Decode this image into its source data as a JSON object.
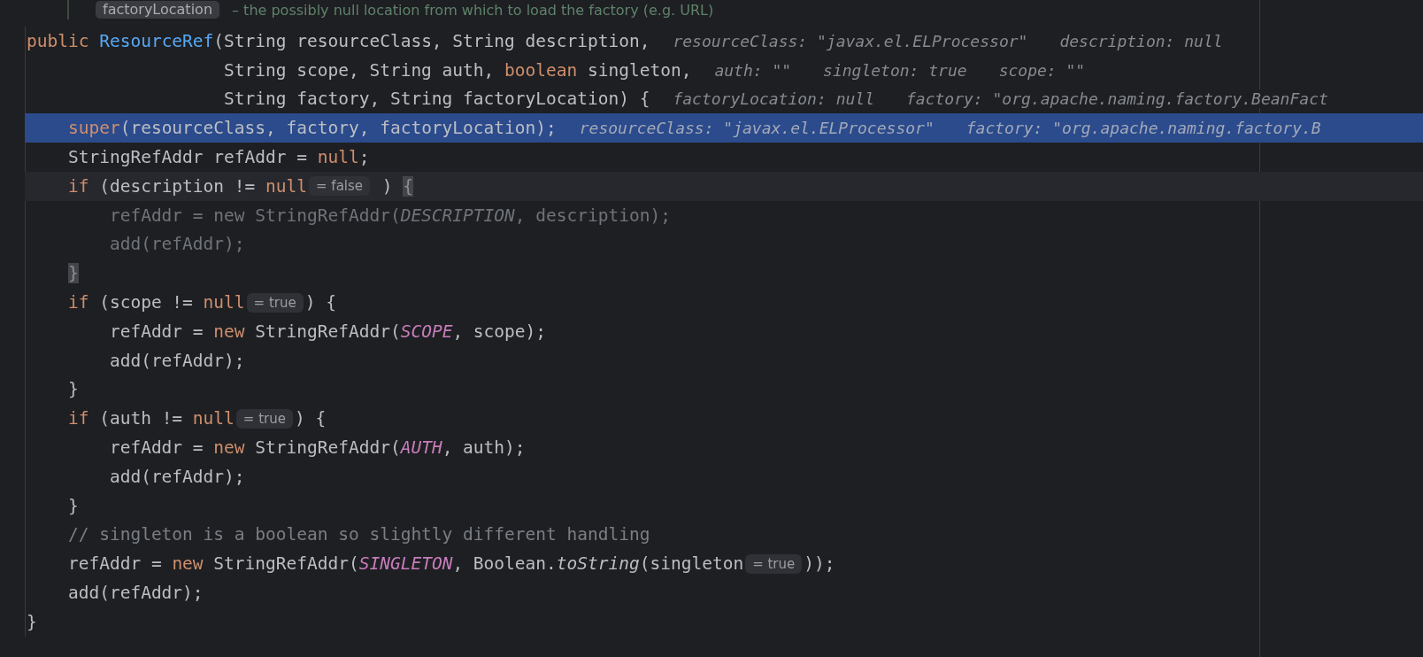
{
  "doc_comment": {
    "tag": "factoryLocation",
    "text": "– the possibly null location from which to load the factory (e.g. URL)"
  },
  "lines": [
    {
      "executing": false,
      "caret": false,
      "tokens": [
        {
          "kind": "keyword",
          "text": "public "
        },
        {
          "kind": "declaration",
          "text": "ResourceRef"
        },
        {
          "kind": "text",
          "text": "(String resourceClass, String description,"
        },
        {
          "kind": "hint",
          "text": "resourceClass: \"javax.el.ELProcessor\""
        },
        {
          "kind": "hint",
          "text": "description: null"
        }
      ]
    },
    {
      "executing": false,
      "caret": false,
      "tokens": [
        {
          "kind": "text",
          "text": "                   String scope, String auth, "
        },
        {
          "kind": "keyword",
          "text": "boolean"
        },
        {
          "kind": "text",
          "text": " singleton,"
        },
        {
          "kind": "hint",
          "text": "auth: \"\""
        },
        {
          "kind": "hint",
          "text": "singleton: true"
        },
        {
          "kind": "hint",
          "text": "scope: \"\""
        }
      ]
    },
    {
      "executing": false,
      "caret": false,
      "tokens": [
        {
          "kind": "text",
          "text": "                   String factory, String factoryLocation) {"
        },
        {
          "kind": "hint",
          "text": "factoryLocation: null"
        },
        {
          "kind": "hint",
          "text": "factory: \"org.apache.naming.factory.BeanFact"
        }
      ]
    },
    {
      "executing": true,
      "caret": false,
      "tokens": [
        {
          "kind": "keyword",
          "text": "    super"
        },
        {
          "kind": "text",
          "text": "(resourceClass, factory, factoryLocation);"
        },
        {
          "kind": "hint",
          "text": "resourceClass: \"javax.el.ELProcessor\""
        },
        {
          "kind": "hint",
          "text": "factory: \"org.apache.naming.factory.B"
        }
      ]
    },
    {
      "executing": false,
      "caret": false,
      "tokens": [
        {
          "kind": "text",
          "text": "    StringRefAddr refAddr = "
        },
        {
          "kind": "keyword",
          "text": "null"
        },
        {
          "kind": "text",
          "text": ";"
        }
      ]
    },
    {
      "executing": false,
      "caret": true,
      "tokens": [
        {
          "kind": "keyword",
          "text": "    if"
        },
        {
          "kind": "text",
          "text": " (description != "
        },
        {
          "kind": "keyword",
          "text": "null"
        },
        {
          "kind": "badge",
          "text": "= false"
        },
        {
          "kind": "text",
          "text": " ) "
        },
        {
          "kind": "brace_match",
          "text": "{"
        }
      ]
    },
    {
      "executing": false,
      "caret": false,
      "tokens": [
        {
          "kind": "dimmed",
          "text": "        refAddr = new StringRefAddr("
        },
        {
          "kind": "dimmed_constant",
          "text": "DESCRIPTION"
        },
        {
          "kind": "dimmed",
          "text": ", description);"
        }
      ]
    },
    {
      "executing": false,
      "caret": false,
      "tokens": [
        {
          "kind": "dimmed",
          "text": "        add(refAddr);"
        }
      ]
    },
    {
      "executing": false,
      "caret": false,
      "tokens": [
        {
          "kind": "brace_match",
          "text": "    }"
        }
      ]
    },
    {
      "executing": false,
      "caret": false,
      "tokens": [
        {
          "kind": "keyword",
          "text": "    if"
        },
        {
          "kind": "text",
          "text": " (scope != "
        },
        {
          "kind": "keyword",
          "text": "null"
        },
        {
          "kind": "badge",
          "text": "= true"
        },
        {
          "kind": "text",
          "text": ") {"
        }
      ]
    },
    {
      "executing": false,
      "caret": false,
      "tokens": [
        {
          "kind": "text",
          "text": "        refAddr = "
        },
        {
          "kind": "keyword",
          "text": "new"
        },
        {
          "kind": "text",
          "text": " StringRefAddr("
        },
        {
          "kind": "constant",
          "text": "SCOPE"
        },
        {
          "kind": "text",
          "text": ", scope);"
        }
      ]
    },
    {
      "executing": false,
      "caret": false,
      "tokens": [
        {
          "kind": "text",
          "text": "        add(refAddr);"
        }
      ]
    },
    {
      "executing": false,
      "caret": false,
      "tokens": [
        {
          "kind": "text",
          "text": "    }"
        }
      ]
    },
    {
      "executing": false,
      "caret": false,
      "tokens": [
        {
          "kind": "keyword",
          "text": "    if"
        },
        {
          "kind": "text",
          "text": " (auth != "
        },
        {
          "kind": "keyword",
          "text": "null"
        },
        {
          "kind": "badge",
          "text": "= true"
        },
        {
          "kind": "text",
          "text": ") {"
        }
      ]
    },
    {
      "executing": false,
      "caret": false,
      "tokens": [
        {
          "kind": "text",
          "text": "        refAddr = "
        },
        {
          "kind": "keyword",
          "text": "new"
        },
        {
          "kind": "text",
          "text": " StringRefAddr("
        },
        {
          "kind": "constant",
          "text": "AUTH"
        },
        {
          "kind": "text",
          "text": ", auth);"
        }
      ]
    },
    {
      "executing": false,
      "caret": false,
      "tokens": [
        {
          "kind": "text",
          "text": "        add(refAddr);"
        }
      ]
    },
    {
      "executing": false,
      "caret": false,
      "tokens": [
        {
          "kind": "text",
          "text": "    }"
        }
      ]
    },
    {
      "executing": false,
      "caret": false,
      "tokens": [
        {
          "kind": "comment",
          "text": "    // singleton is a boolean so slightly different handling"
        }
      ]
    },
    {
      "executing": false,
      "caret": false,
      "tokens": [
        {
          "kind": "text",
          "text": "    refAddr = "
        },
        {
          "kind": "keyword",
          "text": "new"
        },
        {
          "kind": "text",
          "text": " StringRefAddr("
        },
        {
          "kind": "constant",
          "text": "SINGLETON"
        },
        {
          "kind": "text",
          "text": ", Boolean."
        },
        {
          "kind": "method_call",
          "text": "toString"
        },
        {
          "kind": "text",
          "text": "(singleton"
        },
        {
          "kind": "badge",
          "text": "= true"
        },
        {
          "kind": "text",
          "text": "));"
        }
      ]
    },
    {
      "executing": false,
      "caret": false,
      "tokens": [
        {
          "kind": "text",
          "text": "    add(refAddr);"
        }
      ]
    },
    {
      "executing": false,
      "caret": false,
      "tokens": [
        {
          "kind": "text",
          "text": "}"
        }
      ]
    }
  ]
}
